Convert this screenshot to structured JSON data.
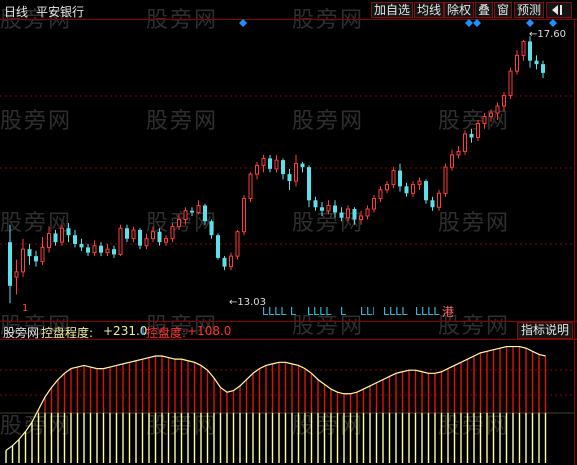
{
  "header": {
    "period": "日线",
    "stock_name": "平安银行",
    "buttons": [
      "加自选",
      "均线",
      "除权",
      "叠",
      "窗",
      "预测"
    ],
    "back_icon": "back-arrow-icon"
  },
  "watermark": "股旁网",
  "price_panel": {
    "high_label": "17.60",
    "low_label": "13.03",
    "signal_text": "LLLL",
    "port_marker": "港",
    "small_marker": "1",
    "diamond_color": "#1e90ff",
    "up_color": "#ff3b3b",
    "down_color": "#5ee0ea"
  },
  "indicator_panel": {
    "source": "股旁网",
    "name": "控盘程度:",
    "value": "+231.0",
    "arrow": "↓",
    "name2": "控盘度:",
    "value2": "+108.0",
    "help_button": "指标说明",
    "name_color": "#f0f0a0",
    "value2_color": "#ff3030"
  },
  "candles": [
    [
      10.0,
      7.5,
      6.5,
      11.0
    ],
    [
      8.0,
      8.3,
      7.0,
      9.0
    ],
    [
      8.3,
      9.6,
      8.0,
      10.2
    ],
    [
      9.6,
      9.2,
      8.7,
      9.9
    ],
    [
      9.2,
      8.9,
      8.6,
      9.5
    ],
    [
      8.9,
      9.7,
      8.7,
      10.3
    ],
    [
      9.7,
      10.5,
      9.4,
      10.9
    ],
    [
      10.5,
      10.0,
      9.8,
      10.7
    ],
    [
      10.0,
      10.8,
      9.8,
      11.0
    ],
    [
      10.8,
      10.4,
      10.0,
      11.1
    ],
    [
      10.4,
      9.9,
      9.7,
      10.7
    ],
    [
      9.9,
      9.7,
      9.5,
      10.2
    ],
    [
      9.7,
      9.4,
      9.2,
      9.9
    ],
    [
      9.4,
      9.8,
      9.2,
      10.1
    ],
    [
      9.8,
      9.4,
      9.2,
      10.0
    ],
    [
      9.4,
      9.6,
      9.2,
      9.9
    ],
    [
      9.6,
      9.3,
      9.1,
      9.8
    ],
    [
      9.3,
      10.8,
      9.2,
      11.0
    ],
    [
      10.8,
      10.2,
      10.0,
      11.0
    ],
    [
      10.2,
      10.7,
      10.0,
      10.9
    ],
    [
      10.7,
      9.8,
      9.6,
      10.8
    ],
    [
      9.8,
      10.2,
      9.6,
      10.5
    ],
    [
      10.2,
      10.6,
      10.0,
      10.9
    ],
    [
      10.6,
      10.0,
      9.8,
      10.8
    ],
    [
      10.0,
      10.2,
      9.8,
      10.4
    ],
    [
      10.2,
      10.9,
      10.0,
      11.1
    ],
    [
      10.9,
      11.3,
      10.7,
      11.6
    ],
    [
      11.3,
      11.8,
      11.0,
      12.0
    ],
    [
      11.8,
      11.7,
      11.5,
      12.0
    ],
    [
      11.7,
      12.1,
      11.6,
      12.4
    ],
    [
      12.1,
      11.2,
      11.0,
      12.2
    ],
    [
      11.2,
      10.4,
      10.2,
      11.3
    ],
    [
      10.4,
      9.1,
      9.0,
      10.5
    ],
    [
      9.1,
      8.6,
      8.4,
      9.2
    ],
    [
      8.6,
      9.2,
      8.4,
      9.4
    ],
    [
      9.2,
      10.6,
      9.0,
      10.7
    ],
    [
      10.6,
      12.5,
      10.4,
      12.7
    ],
    [
      12.5,
      13.9,
      12.3,
      14.0
    ],
    [
      13.9,
      14.4,
      13.6,
      14.6
    ],
    [
      14.4,
      14.8,
      14.0,
      15.0
    ],
    [
      14.8,
      14.2,
      14.0,
      15.0
    ],
    [
      14.2,
      14.7,
      14.0,
      15.0
    ],
    [
      14.7,
      13.9,
      13.6,
      14.8
    ],
    [
      13.9,
      13.5,
      13.0,
      14.2
    ],
    [
      13.5,
      14.5,
      13.2,
      15.0
    ],
    [
      14.5,
      14.3,
      14.0,
      14.6
    ],
    [
      14.3,
      12.4,
      12.0,
      14.4
    ],
    [
      12.4,
      12.0,
      11.8,
      12.6
    ],
    [
      12.0,
      11.8,
      11.5,
      12.3
    ],
    [
      11.8,
      12.1,
      11.6,
      12.4
    ],
    [
      12.1,
      11.7,
      11.4,
      12.4
    ],
    [
      11.7,
      11.4,
      11.2,
      12.0
    ],
    [
      11.4,
      11.9,
      11.2,
      12.1
    ],
    [
      11.9,
      11.3,
      11.0,
      12.0
    ],
    [
      11.3,
      11.5,
      11.0,
      11.8
    ],
    [
      11.5,
      11.9,
      11.3,
      12.1
    ],
    [
      11.9,
      12.5,
      11.7,
      12.7
    ],
    [
      12.5,
      13.0,
      12.3,
      13.2
    ],
    [
      13.0,
      13.3,
      12.8,
      13.5
    ],
    [
      13.3,
      14.1,
      13.1,
      14.3
    ],
    [
      14.1,
      13.2,
      12.9,
      14.5
    ],
    [
      13.2,
      12.8,
      12.6,
      13.4
    ],
    [
      12.8,
      13.3,
      12.6,
      13.5
    ],
    [
      13.3,
      13.5,
      13.0,
      13.7
    ],
    [
      13.5,
      12.4,
      12.2,
      13.6
    ],
    [
      12.4,
      12.0,
      11.8,
      12.6
    ],
    [
      12.0,
      12.8,
      11.8,
      13.0
    ],
    [
      12.8,
      14.3,
      12.6,
      14.5
    ],
    [
      14.3,
      15.0,
      14.1,
      15.3
    ],
    [
      15.0,
      15.2,
      14.8,
      15.5
    ],
    [
      15.2,
      16.2,
      15.0,
      16.4
    ],
    [
      16.2,
      16.0,
      15.7,
      16.5
    ],
    [
      16.0,
      16.8,
      15.8,
      17.0
    ],
    [
      16.8,
      17.2,
      16.5,
      17.4
    ],
    [
      17.2,
      17.4,
      16.9,
      17.6
    ],
    [
      17.4,
      17.8,
      17.0,
      18.0
    ],
    [
      17.8,
      18.4,
      17.5,
      18.6
    ],
    [
      18.4,
      19.8,
      18.2,
      20.0
    ],
    [
      19.8,
      20.7,
      19.6,
      21.0
    ],
    [
      20.7,
      21.5,
      20.4,
      21.6
    ],
    [
      21.5,
      20.4,
      20.0,
      21.8
    ],
    [
      20.4,
      20.2,
      19.9,
      20.7
    ],
    [
      20.2,
      19.7,
      19.4,
      20.4
    ]
  ],
  "control_values": [
    8,
    11,
    15,
    20,
    26,
    34,
    42,
    48,
    53,
    57,
    60,
    61,
    62,
    61,
    60,
    60,
    61,
    62,
    63,
    64,
    65,
    66,
    67,
    68,
    68,
    67,
    66,
    66,
    65,
    64,
    62,
    59,
    54,
    48,
    45,
    46,
    49,
    53,
    57,
    60,
    62,
    63,
    64,
    64,
    63,
    62,
    60,
    57,
    53,
    50,
    47,
    45,
    44,
    44,
    45,
    47,
    49,
    51,
    53,
    55,
    57,
    58,
    59,
    59,
    58,
    57,
    57,
    58,
    60,
    62,
    64,
    66,
    68,
    70,
    71,
    72,
    73,
    74,
    74,
    74,
    73,
    71,
    69,
    68
  ],
  "diamonds_x": [
    243,
    469,
    477,
    530,
    553
  ],
  "signal_positions": [
    262,
    290,
    313,
    343,
    360,
    382,
    414
  ]
}
